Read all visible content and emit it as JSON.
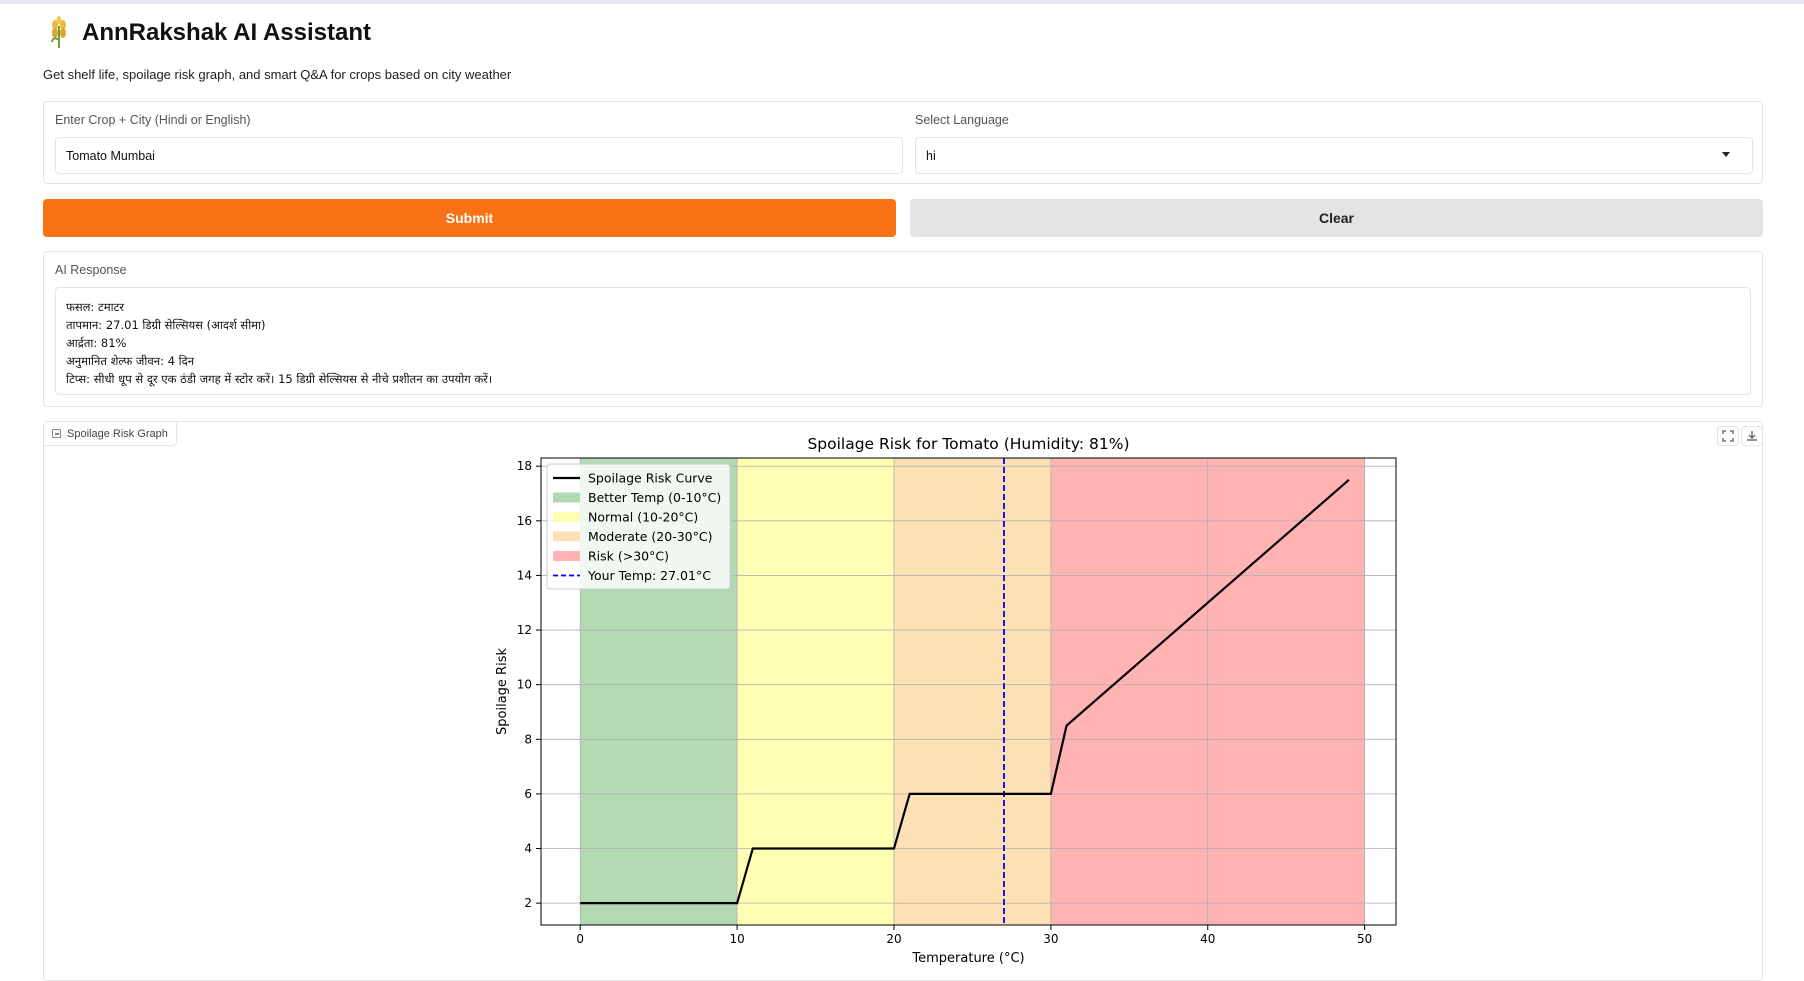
{
  "app": {
    "title": "AnnRakshak AI Assistant",
    "subtitle": "Get shelf life, spoilage risk graph, and smart Q&A for crops based on city weather",
    "logo_icon": "wheat-icon"
  },
  "form": {
    "crop_city_label": "Enter Crop + City (Hindi or English)",
    "crop_city_value": "Tomato Mumbai",
    "language_label": "Select Language",
    "language_value": "hi"
  },
  "buttons": {
    "submit_label": "Submit",
    "clear_label": "Clear",
    "submit_color": "#f97316",
    "clear_color": "#e4e4e7"
  },
  "response": {
    "label": "AI Response",
    "lines": [
      "फसल: टमाटर",
      "तापमान: 27.01 डिग्री सेल्सियस (आदर्श सीमा)",
      "आर्द्रता: 81%",
      "अनुमानित शेल्फ जीवन: 4 दिन",
      "टिप्स: सीधी धूप से दूर एक ठंडी जगह में स्टोर करें। 15 डिग्री सेल्सियस से नीचे प्रशीतन का उपयोग करें।"
    ]
  },
  "graph_panel": {
    "label": "Spoilage Risk Graph",
    "fullscreen_icon": "fullscreen-icon",
    "download_icon": "download-icon"
  },
  "chart_data": {
    "type": "line",
    "title": "Spoilage Risk for Tomato (Humidity: 81%)",
    "xlabel": "Temperature (°C)",
    "ylabel": "Spoilage Risk",
    "xlim": [
      -2.5,
      52.0
    ],
    "ylim": [
      1.2,
      18.3
    ],
    "xticks": [
      0,
      10,
      20,
      30,
      40,
      50
    ],
    "yticks": [
      2,
      4,
      6,
      8,
      10,
      12,
      14,
      16,
      18
    ],
    "grid": true,
    "legend_position": "top-left",
    "series": [
      {
        "name": "Spoilage Risk Curve",
        "color": "#000000",
        "x": [
          0,
          10,
          11,
          20,
          21,
          30,
          31,
          49
        ],
        "y": [
          2,
          2,
          4,
          4,
          6,
          6,
          8.5,
          17.5
        ]
      }
    ],
    "bands": [
      {
        "name": "Better Temp (0-10°C)",
        "from": 0,
        "to": 10,
        "color": "#b3d9b3"
      },
      {
        "name": "Normal (10-20°C)",
        "from": 10,
        "to": 20,
        "color": "#ffffb3"
      },
      {
        "name": "Moderate (20-30°C)",
        "from": 20,
        "to": 30,
        "color": "#fde0b3"
      },
      {
        "name": "Risk (>30°C)",
        "from": 30,
        "to": 50,
        "color": "#ffb3b3"
      }
    ],
    "vline": {
      "name": "Your Temp: 27.01°C",
      "x": 27.01,
      "color": "#0000ff"
    }
  }
}
